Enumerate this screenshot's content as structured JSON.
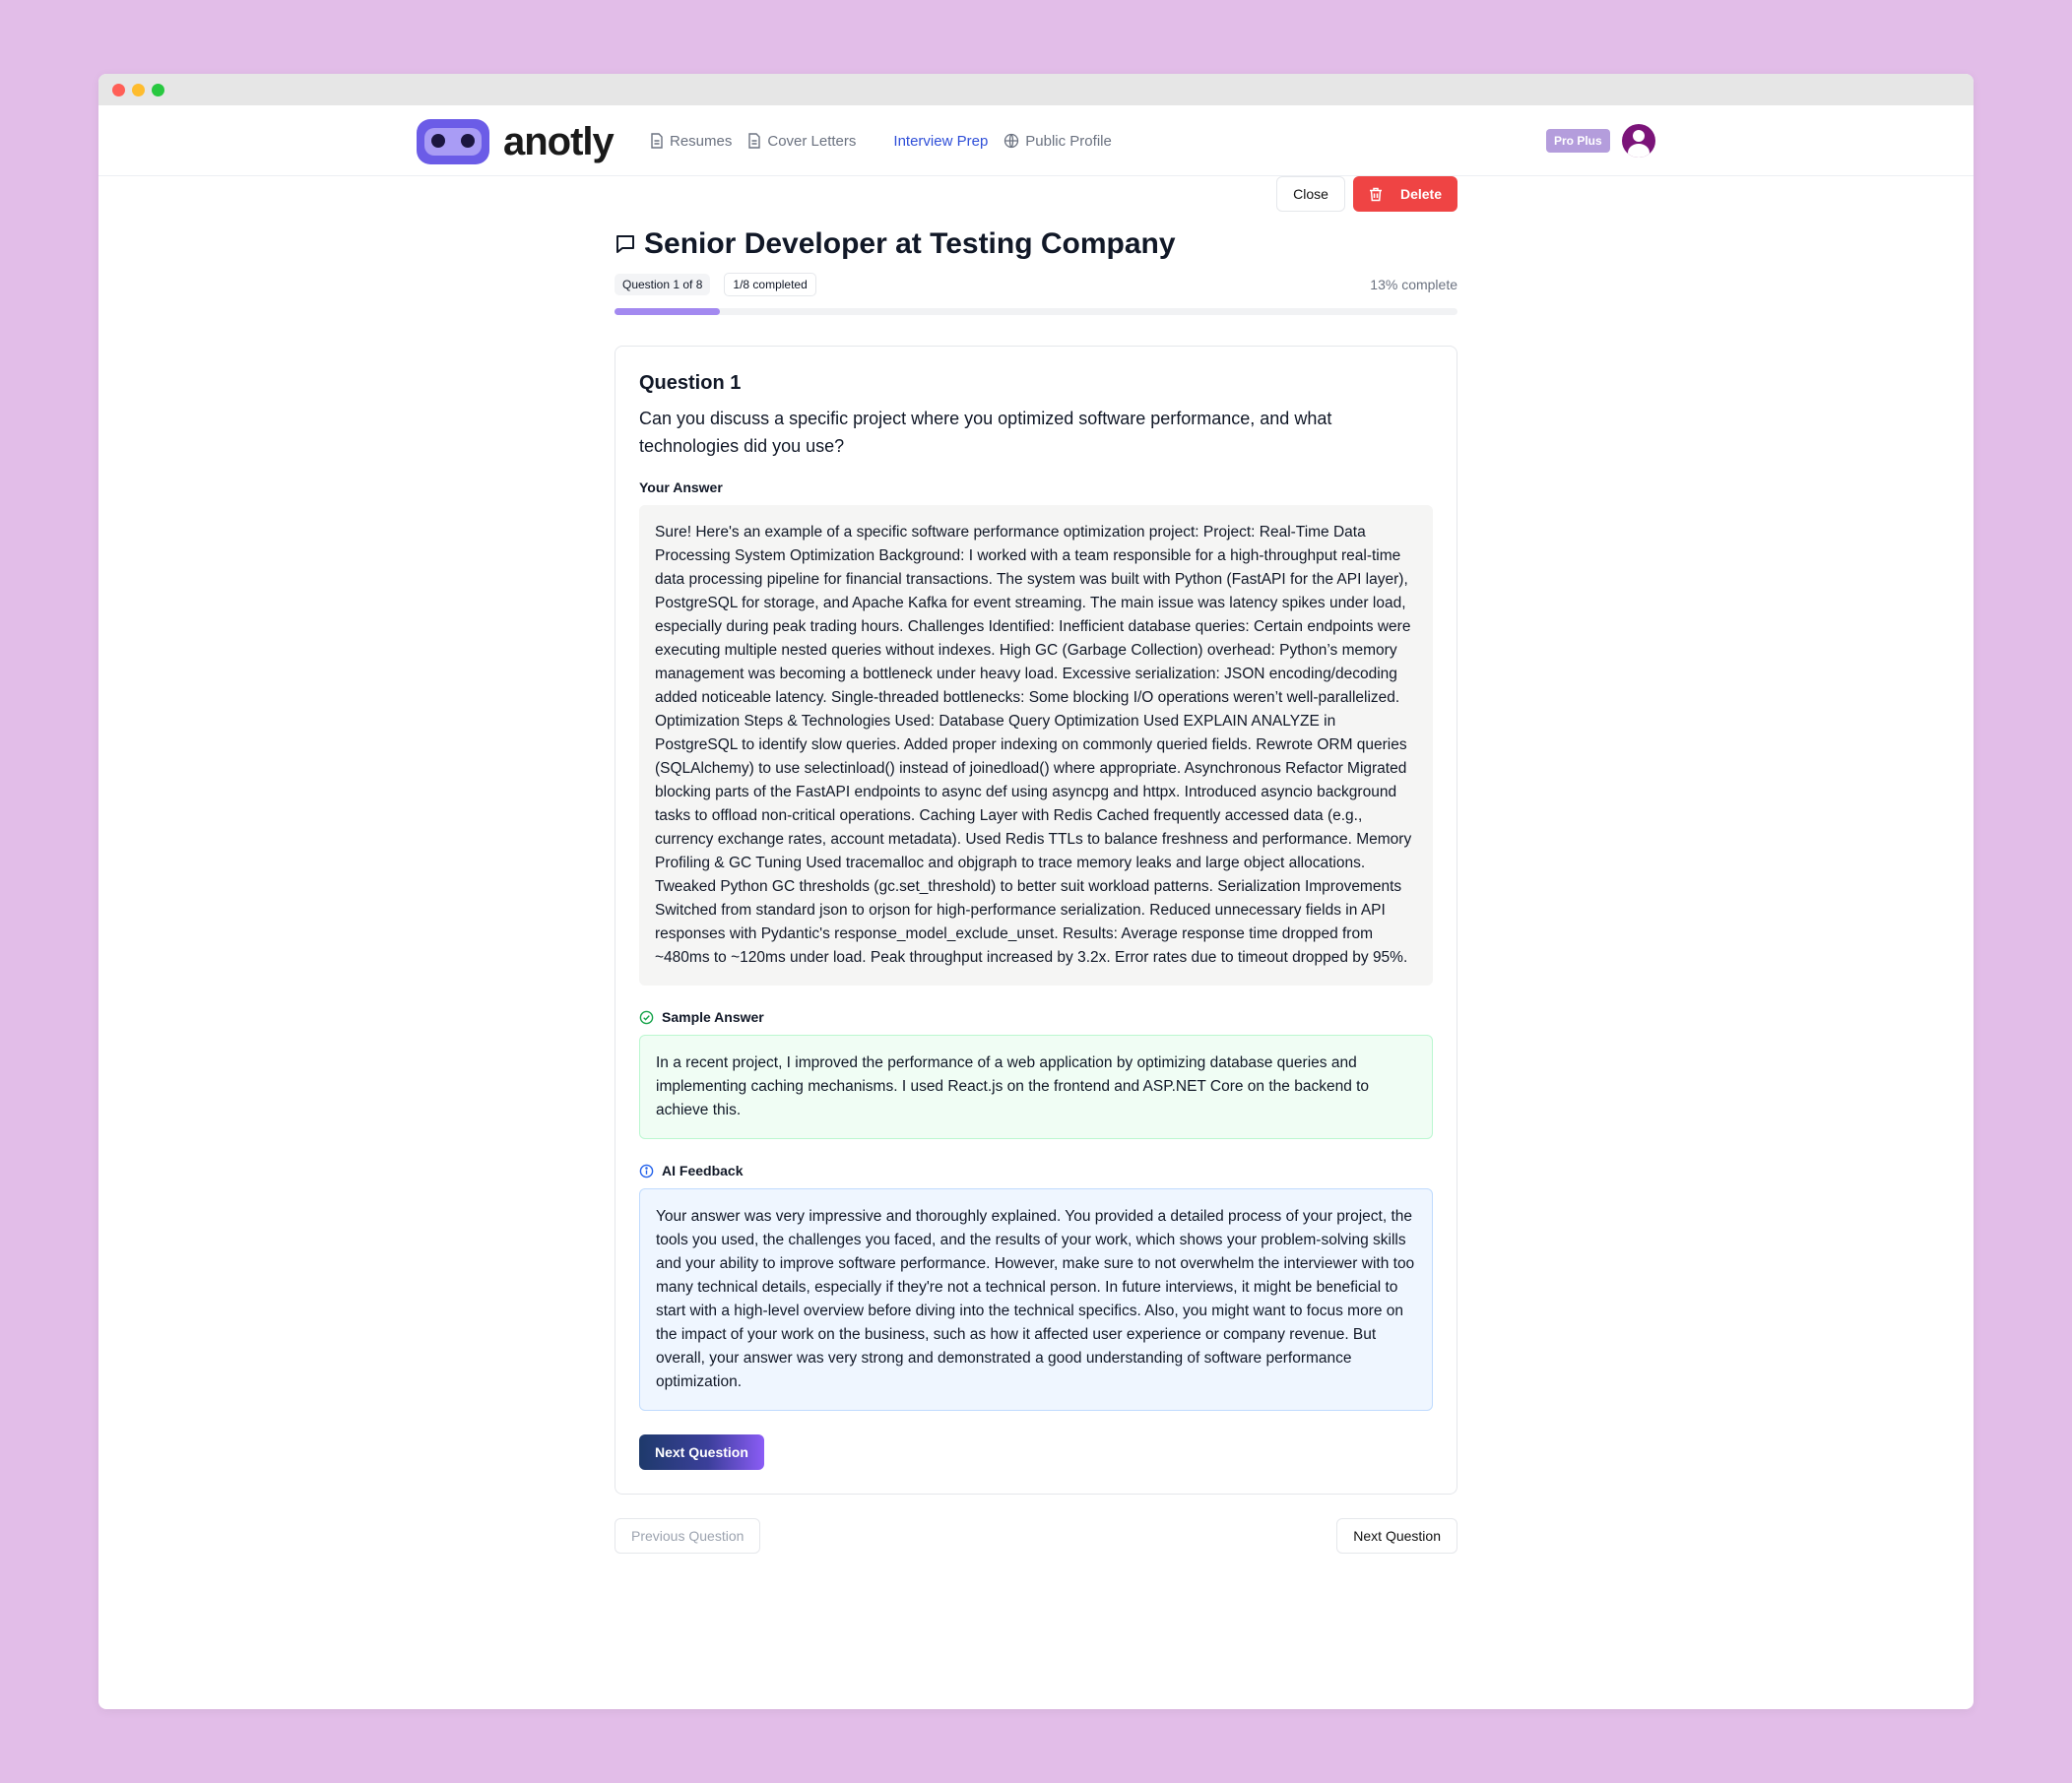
{
  "app": {
    "logo_text": "anotly",
    "accent_color": "#6b5ce7"
  },
  "nav": {
    "items": [
      {
        "label": "Resumes",
        "icon": "document-icon"
      },
      {
        "label": "Cover Letters",
        "icon": "document-icon"
      },
      {
        "label": "Interview Prep",
        "icon": "none",
        "active": true
      },
      {
        "label": "Public Profile",
        "icon": "globe-icon"
      }
    ],
    "plan_badge": "Pro Plus"
  },
  "toolbar": {
    "close_label": "Close",
    "delete_label": "Delete"
  },
  "session": {
    "title": "Senior Developer at Testing Company",
    "question_counter": "Question 1 of 8",
    "completed_counter": "1/8 completed",
    "percent_label": "13% complete",
    "progress_fraction": 0.125
  },
  "question": {
    "heading": "Question 1",
    "text": "Can you discuss a specific project where you optimized software performance, and what technologies did you use?",
    "answer_label": "Your Answer",
    "answer": "Sure! Here's an example of a specific software performance optimization project: Project: Real-Time Data Processing System Optimization Background: I worked with a team responsible for a high-throughput real-time data processing pipeline for financial transactions. The system was built with Python (FastAPI for the API layer), PostgreSQL for storage, and Apache Kafka for event streaming. The main issue was latency spikes under load, especially during peak trading hours. Challenges Identified: Inefficient database queries: Certain endpoints were executing multiple nested queries without indexes. High GC (Garbage Collection) overhead: Python’s memory management was becoming a bottleneck under heavy load. Excessive serialization: JSON encoding/decoding added noticeable latency. Single-threaded bottlenecks: Some blocking I/O operations weren’t well-parallelized. Optimization Steps & Technologies Used: Database Query Optimization Used EXPLAIN ANALYZE in PostgreSQL to identify slow queries. Added proper indexing on commonly queried fields. Rewrote ORM queries (SQLAlchemy) to use selectinload() instead of joinedload() where appropriate. Asynchronous Refactor Migrated blocking parts of the FastAPI endpoints to async def using asyncpg and httpx. Introduced asyncio background tasks to offload non-critical operations. Caching Layer with Redis Cached frequently accessed data (e.g., currency exchange rates, account metadata). Used Redis TTLs to balance freshness and performance. Memory Profiling & GC Tuning Used tracemalloc and objgraph to trace memory leaks and large object allocations. Tweaked Python GC thresholds (gc.set_threshold) to better suit workload patterns. Serialization Improvements Switched from standard json to orjson for high-performance serialization. Reduced unnecessary fields in API responses with Pydantic's response_model_exclude_unset. Results: Average response time dropped from ~480ms to ~120ms under load. Peak throughput increased by 3.2x. Error rates due to timeout dropped by 95%.",
    "sample_label": "Sample Answer",
    "sample": "In a recent project, I improved the performance of a web application by optimizing database queries and implementing caching mechanisms. I used React.js on the frontend and ASP.NET Core on the backend to achieve this.",
    "feedback_label": "AI Feedback",
    "feedback": "Your answer was very impressive and thoroughly explained. You provided a detailed process of your project, the tools you used, the challenges you faced, and the results of your work, which shows your problem-solving skills and your ability to improve software performance. However, make sure to not overwhelm the interviewer with too many technical details, especially if they're not a technical person. In future interviews, it might be beneficial to start with a high-level overview before diving into the technical specifics. Also, you might want to focus more on the impact of your work on the business, such as how it affected user experience or company revenue. But overall, your answer was very strong and demonstrated a good understanding of software performance optimization.",
    "next_label": "Next Question"
  },
  "footer": {
    "prev_label": "Previous Question",
    "next_label": "Next Question"
  }
}
